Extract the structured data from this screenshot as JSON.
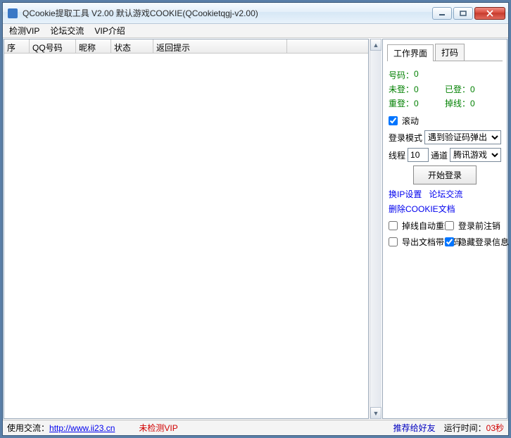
{
  "window": {
    "title": "QCookie提取工具 V2.00 默认游戏COOKIE(QCookietqgj-v2.00)"
  },
  "menubar": {
    "items": [
      "检测VIP",
      "论坛交流",
      "VIP介绍"
    ]
  },
  "table": {
    "columns": {
      "seq": "序",
      "qq": "QQ号码",
      "nick": "昵称",
      "status": "状态",
      "msg": "返回提示"
    },
    "rows": []
  },
  "side": {
    "tabs": {
      "work": "工作界面",
      "dama": "打码"
    },
    "stats": {
      "num_label": "号码：",
      "num_val": "0",
      "wd_label": "未登：",
      "wd_val": "0",
      "yd_label": "已登：",
      "yd_val": "0",
      "cd_label": "重登：",
      "cd_val": "0",
      "dx_label": "掉线：",
      "dx_val": "0"
    },
    "scroll_label": "滚动",
    "mode_label": "登录模式",
    "mode_value": "遇到验证码弹出",
    "thread_label": "线程",
    "thread_value": "10",
    "chan_label": "通道",
    "chan_value": "腾讯游戏",
    "start_btn": "开始登录",
    "links": {
      "ip": "换IP设置",
      "forum": "论坛交流",
      "delcookie": "删除COOKIE文档"
    },
    "checks": {
      "autoRe": "掉线自动重登",
      "logoutBefore": "登录前注销",
      "exportPwd": "导出文档带密码",
      "hideInfo": "隐藏登录信息"
    }
  },
  "statusbar": {
    "use_label": "使用交流：",
    "use_link": "http://www.ii23.cn",
    "vip_status": "未检测VIP",
    "recommend": "推荐给好友",
    "runtime_label": "运行时间：",
    "runtime_value": "03秒"
  }
}
